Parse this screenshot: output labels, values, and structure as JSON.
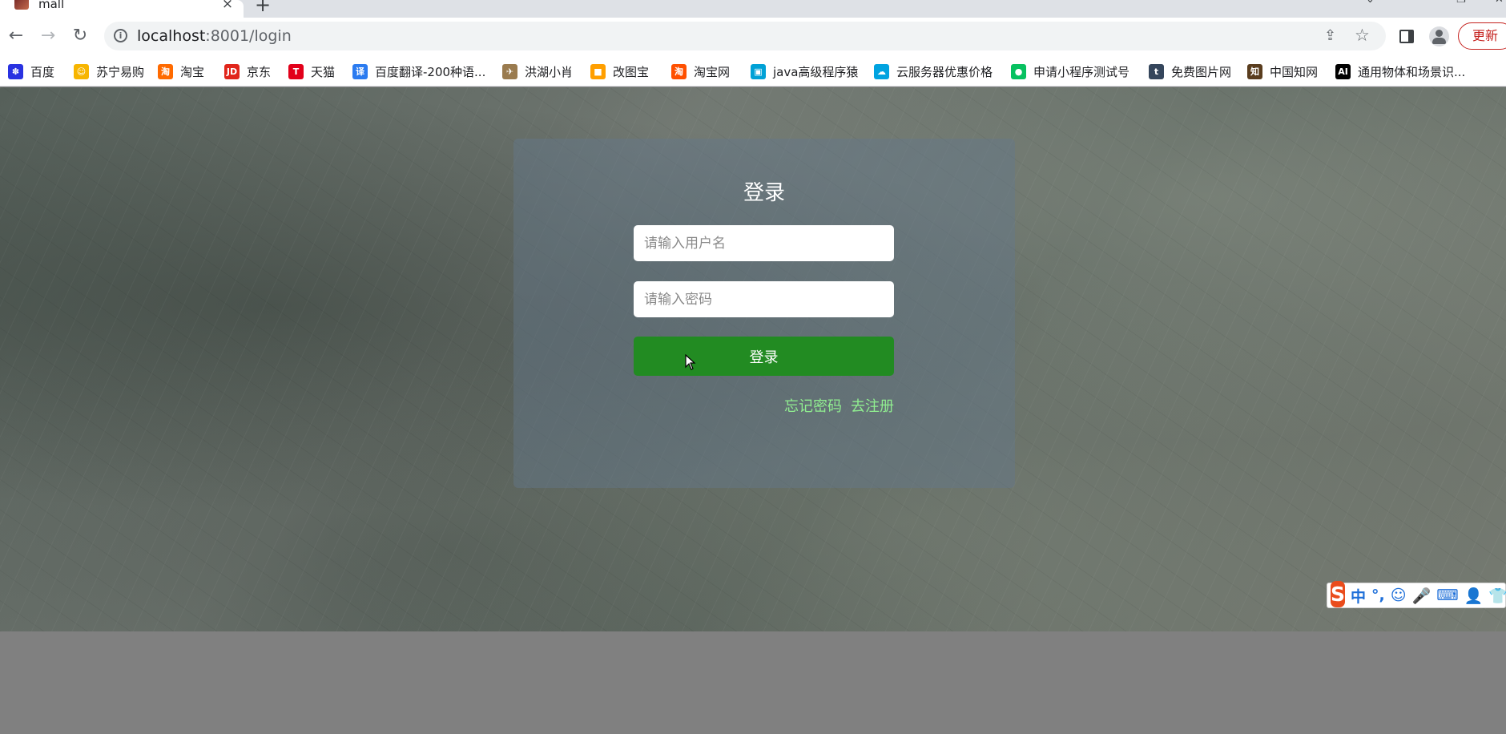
{
  "tab": {
    "title": "mall",
    "close": "×"
  },
  "newtab": "+",
  "window": {
    "minimize": "⌄",
    "restore": "❐",
    "close": "✕"
  },
  "toolbar": {
    "back": "←",
    "forward": "→",
    "reload": "↻",
    "url_host": "localhost",
    "url_rest": ":8001/login",
    "share": "⇪",
    "star": "☆",
    "update": "更新"
  },
  "bookmarks": [
    {
      "label": "百度",
      "icon": "baidu-icon",
      "color": "#2932e1",
      "glyph": "✽"
    },
    {
      "label": "苏宁易购",
      "icon": "suning-icon",
      "color": "#f7b500",
      "glyph": "☺"
    },
    {
      "label": "淘宝",
      "icon": "taobao-icon",
      "color": "#ff6a00",
      "glyph": "淘"
    },
    {
      "label": "京东",
      "icon": "jd-icon",
      "color": "#e1251b",
      "glyph": "JD"
    },
    {
      "label": "天猫",
      "icon": "tmall-icon",
      "color": "#e2001a",
      "glyph": "T"
    },
    {
      "label": "百度翻译-200种语...",
      "icon": "baidu-translate-icon",
      "color": "#2b7bf0",
      "glyph": "译"
    },
    {
      "label": "洪湖小肖",
      "icon": "bird-icon",
      "color": "#9a7b4f",
      "glyph": "✈"
    },
    {
      "label": "改图宝",
      "icon": "gaitubao-icon",
      "color": "#ff9f00",
      "glyph": "■"
    },
    {
      "label": "淘宝网",
      "icon": "taobao-net-icon",
      "color": "#ff5000",
      "glyph": "淘"
    },
    {
      "label": "java高级程序猿",
      "icon": "bilibili-icon",
      "color": "#00a1d6",
      "glyph": "▣"
    },
    {
      "label": "云服务器优惠价格",
      "icon": "cloud-icon",
      "color": "#00a3e0",
      "glyph": "☁"
    },
    {
      "label": "申请小程序测试号",
      "icon": "wechat-icon",
      "color": "#07c160",
      "glyph": "●"
    },
    {
      "label": "免费图片网",
      "icon": "tumblr-icon",
      "color": "#35465c",
      "glyph": "t"
    },
    {
      "label": "中国知网",
      "icon": "cnki-icon",
      "color": "#5a3d1e",
      "glyph": "知"
    },
    {
      "label": "通用物体和场景识...",
      "icon": "ai-icon",
      "color": "#000000",
      "glyph": "AI"
    }
  ],
  "login": {
    "title": "登录",
    "username_placeholder": "请输入用户名",
    "password_placeholder": "请输入密码",
    "submit": "登录",
    "forgot": "忘记密码",
    "register": "去注册"
  },
  "ime": {
    "logo": "S",
    "items": [
      "中",
      "°,",
      "☺",
      "🎤",
      "⌨",
      "👤",
      "👕"
    ]
  },
  "colors": {
    "submit_bg": "#228b22",
    "link": "#90ee90",
    "update_red": "#c5221f"
  }
}
